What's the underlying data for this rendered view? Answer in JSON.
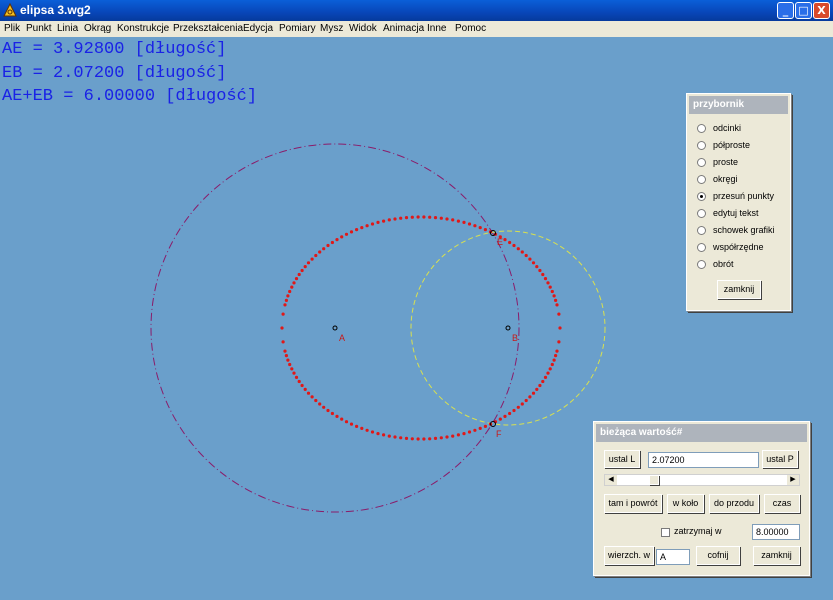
{
  "window": {
    "title": "elipsa 3.wg2",
    "buttons": {
      "minimize": "_",
      "maximize": "□",
      "close": "X"
    }
  },
  "menu": [
    "Plik",
    "Punkt",
    "Linia",
    "Okrąg",
    "Konstrukcje",
    "Przekształcenia",
    "Edycja",
    "Pomiary",
    "Mysz",
    "Widok",
    "Animacja",
    "Inne",
    "Pomoc"
  ],
  "measurements": [
    "AE = 3.92800 [długość]",
    "EB = 2.07200 [długość]",
    "AE+EB = 6.00000 [długość]"
  ],
  "points": {
    "A": "A",
    "B": "B",
    "E": "E",
    "F": "F"
  },
  "toolbox": {
    "title": "przybornik",
    "options": [
      "odcinki",
      "półproste",
      "proste",
      "okręgi",
      "przesuń punkty",
      "edytuj tekst",
      "schowek grafiki",
      "współrzędne",
      "obrót"
    ],
    "selected_index": 4,
    "close_label": "zamknij"
  },
  "current_value": {
    "title": "bieżąca wartość#",
    "set_left": "ustal L",
    "value": "2.07200",
    "set_right": "ustal P",
    "slider_level": 0.2,
    "btn_back_forth": "tam i powrót",
    "btn_loop": "w koło",
    "btn_forward": "do przodu",
    "btn_time": "czas",
    "stop_label": "zatrzymaj w",
    "stop_checked": false,
    "stop_value": "8.00000",
    "vertex_label": "wierzch. w",
    "vertex_value": "A",
    "btn_undo": "cofnij",
    "btn_close": "zamknij"
  },
  "colors": {
    "background": "#6a9fcb",
    "measure_text": "#1a22e6",
    "ellipse": "#e01818",
    "circle_a": "#8a1c6a",
    "circle_b": "#d8e050",
    "point_label": "#c81818"
  }
}
